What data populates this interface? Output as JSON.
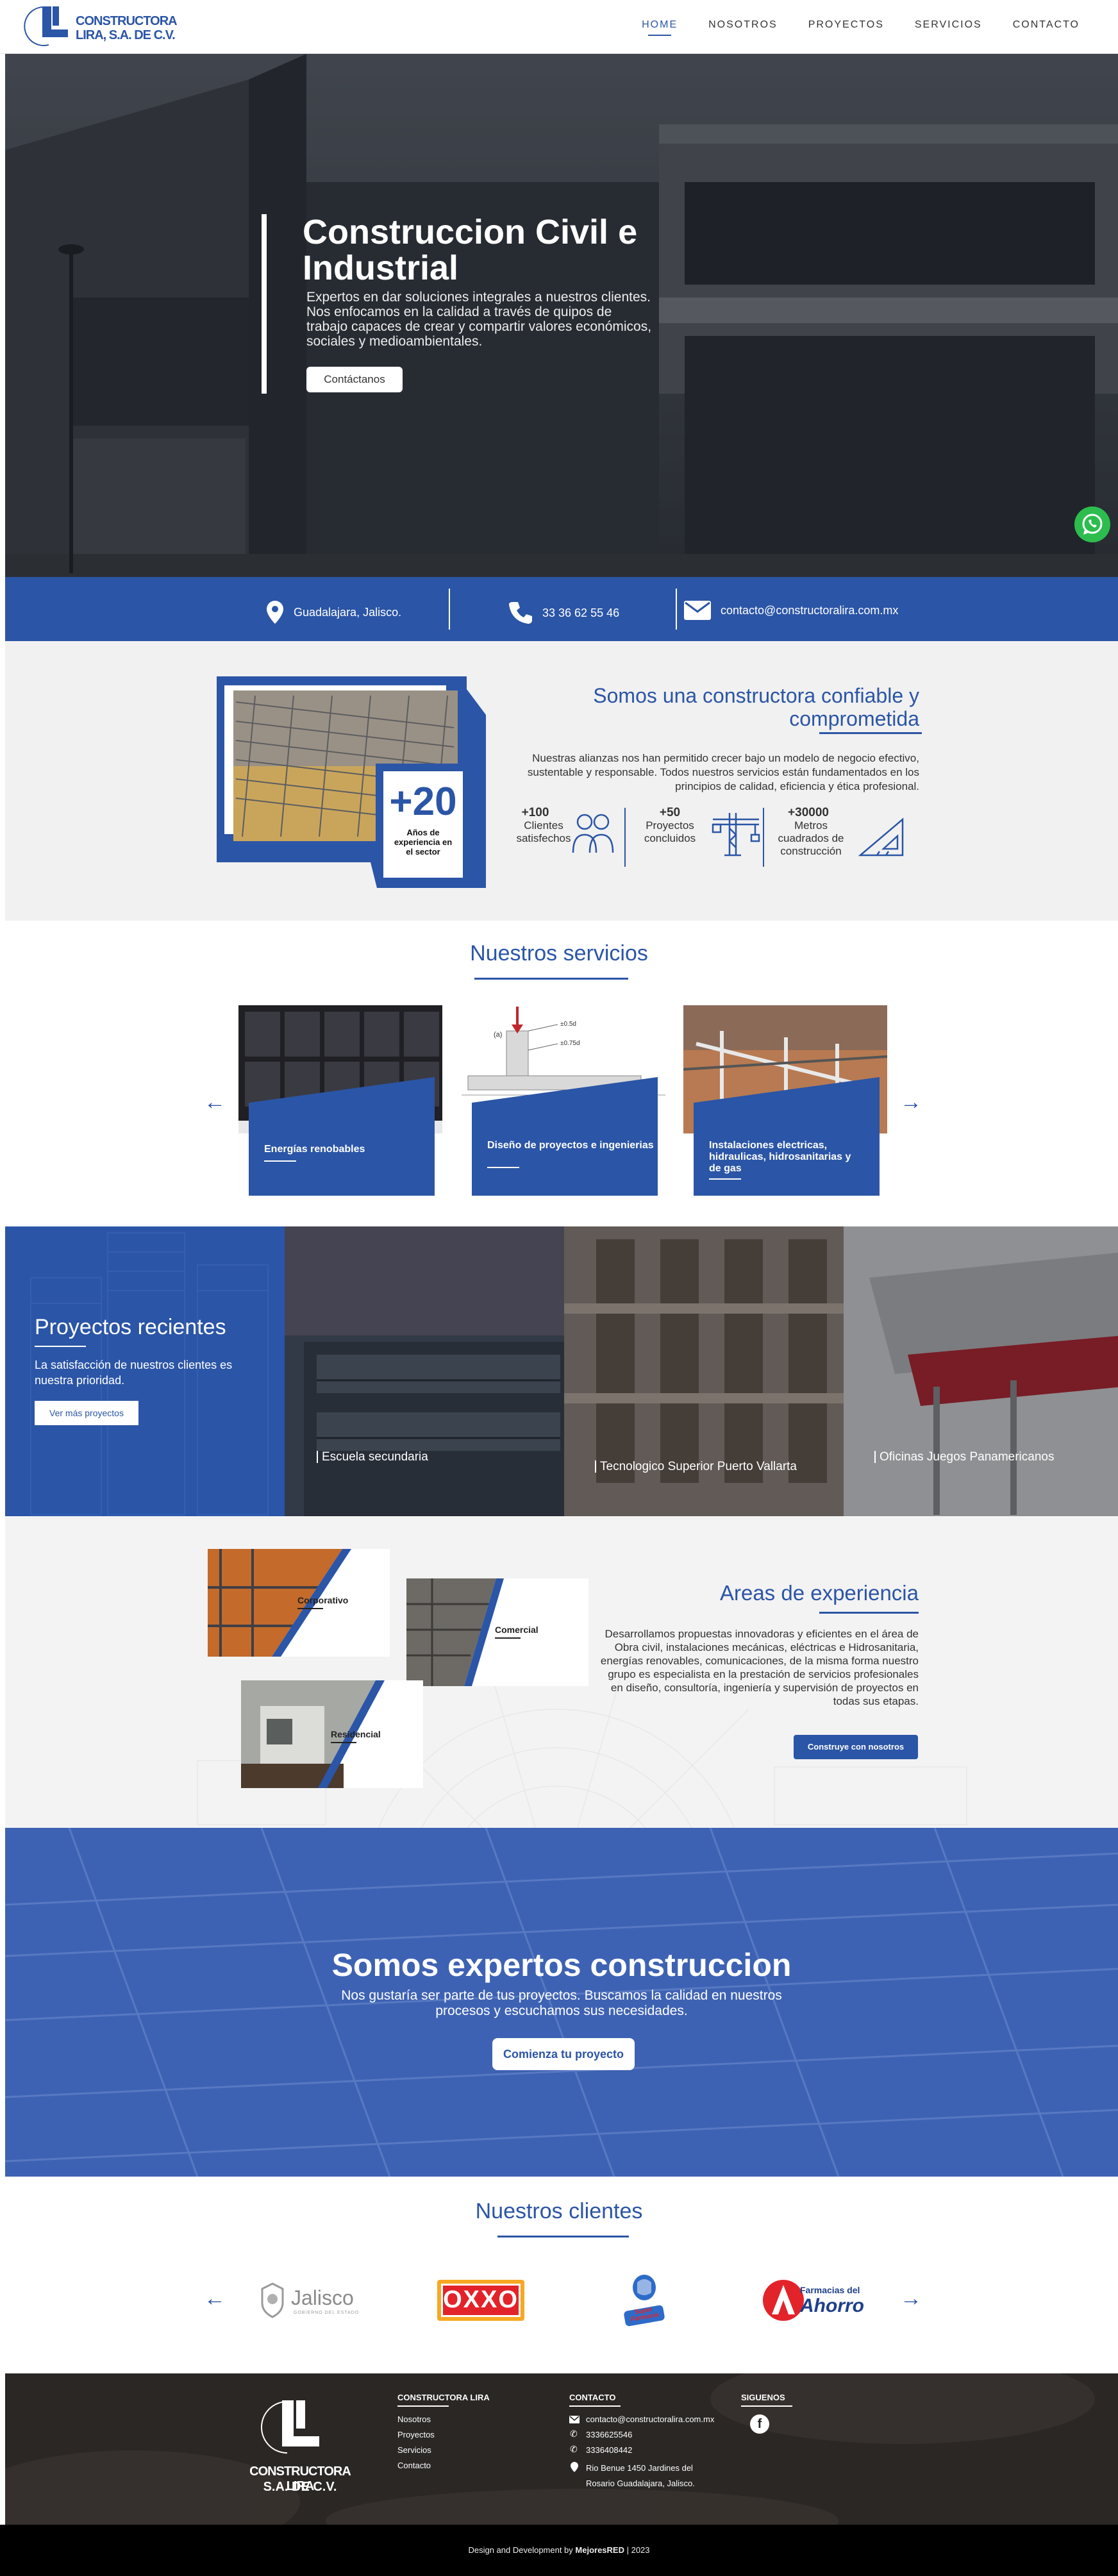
{
  "header": {
    "logo_line1": "CONSTRUCTORA",
    "logo_line2": "LIRA, S.A. DE C.V.",
    "nav": [
      "HOME",
      "NOSOTROS",
      "PROYECTOS",
      "SERVICIOS",
      "CONTACTO"
    ],
    "active_nav": "HOME"
  },
  "hero": {
    "title": "Construccion Civil e Industrial",
    "subtitle": "Expertos en dar soluciones integrales a nuestros clientes. Nos enfocamos en la calidad a través de quipos de trabajo capaces de crear y compartir valores económicos, sociales y medioambientales.",
    "button": "Contáctanos"
  },
  "contact_bar": {
    "location": "Guadalajara, Jalisco.",
    "phone": "33 36 62 55 46",
    "email": "contacto@constructoralira.com.mx"
  },
  "about": {
    "badge_number": "+20",
    "badge_text": "Años de experiencia en el sector",
    "title": "Somos una constructora confiable y comprometida",
    "text": "Nuestras alianzas nos han permitido crecer bajo un modelo de negocio efectivo, sustentable y responsable. Todos nuestros servicios están fundamentados en los principios de calidad, eficiencia y ética profesional.",
    "stats": [
      {
        "value": "+100",
        "label": "Clientes satisfechos",
        "icon": "users-icon"
      },
      {
        "value": "+50",
        "label": "Proyectos concluidos",
        "icon": "crane-icon"
      },
      {
        "value": "+30000",
        "label": "Metros cuadrados de construcción",
        "icon": "set-square-icon"
      }
    ]
  },
  "services": {
    "title": "Nuestros servicios",
    "items": [
      "Energías renobables",
      "Diseño de proyectos e ingenierias",
      "Instalaciones electricas, hidraulicas, hidrosanitarias y de gas"
    ],
    "diagram_labels": [
      "(a)",
      "±0.5d",
      "±0.75d"
    ]
  },
  "projects": {
    "title": "Proyectos recientes",
    "text": "La satisfacción de nuestros clientes es nuestra prioridad.",
    "button": "Ver más proyectos",
    "items": [
      "Escuela secundaria",
      "Tecnologico Superior Puerto Vallarta",
      "Oficinas Juegos Panamericanos"
    ]
  },
  "areas": {
    "title": "Areas de experiencia",
    "text": "Desarrollamos propuestas innovadoras y eficientes en el área de Obra civil, instalaciones mecánicas, eléctricas e Hidrosanitaria, energías renovables, comunicaciones, de la misma forma nuestro grupo es especialista en la prestación de servicios profesionales en diseño, consultoría, ingeniería y supervisión de proyectos en todas sus etapas.",
    "button": "Construye con nosotros",
    "cards": [
      "Corporativo",
      "Comercial",
      "Residencial"
    ]
  },
  "cta": {
    "title": "Somos expertos construccion",
    "subtitle": "Nos gustaría ser parte de tus proyectos. Buscamos la calidad en nuestros procesos y escuchamos sus necesidades.",
    "button": "Comienza tu proyecto"
  },
  "clients": {
    "title": "Nuestros clientes",
    "logos": [
      "Jalisco",
      "OXXO",
      "Super Farmacia",
      "Farmacias del Ahorro"
    ],
    "jalisco_sub": "GOBIERNO DEL ESTADO",
    "ahorro_top": "Farmacias del",
    "ahorro_main": "Ahorro"
  },
  "footer": {
    "logo_line1": "CONSTRUCTORA LIRA",
    "logo_line2": "S.A. DE C.V.",
    "col1_title": "CONSTRUCTORA LIRA",
    "col1_links": [
      "Nosotros",
      "Proyectos",
      "Servicios",
      "Contacto"
    ],
    "col2_title": "CONTACTO",
    "email": "contacto@constructoralira.com.mx",
    "phone1": "3336625546",
    "phone2": "3336408442",
    "address": "Rio Benue 1450 Jardines del Rosario Guadalajara, Jalisco.",
    "col3_title": "SIGUENOS",
    "copyright_prefix": "Design and Development by ",
    "copyright_brand": "MejoresRED",
    "copyright_suffix": " | 2023"
  },
  "colors": {
    "brand_blue": "#2b55a6",
    "whatsapp": "#2dbd4e",
    "footer": "#242424"
  }
}
